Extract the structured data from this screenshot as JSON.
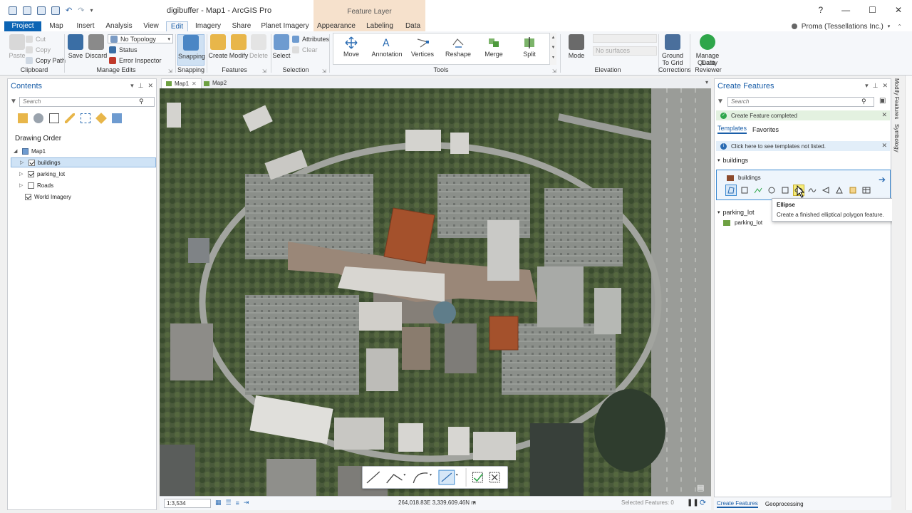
{
  "app": {
    "title": "digibuffer - Map1 - ArcGIS Pro",
    "context_tab_group": "Feature Layer",
    "window_controls": [
      "?",
      "—",
      "☐",
      "✕"
    ]
  },
  "tabs": [
    "Project",
    "Map",
    "Insert",
    "Analysis",
    "View",
    "Edit",
    "Imagery",
    "Share",
    "Planet Imagery",
    "Appearance",
    "Labeling",
    "Data"
  ],
  "active_tab": "Edit",
  "user": {
    "name": "Proma (Tessellations Inc.)"
  },
  "ribbon": {
    "clipboard": {
      "paste": "Paste",
      "cut": "Cut",
      "copy": "Copy",
      "copy_path": "Copy Path",
      "label": "Clipboard"
    },
    "manage_edits": {
      "save": "Save",
      "discard": "Discard",
      "topology_value": "No Topology",
      "status": "Status",
      "error_inspector": "Error Inspector",
      "label": "Manage Edits"
    },
    "snapping": {
      "button": "Snapping",
      "label": "Snapping"
    },
    "features": {
      "create": "Create",
      "modify": "Modify",
      "delete": "Delete",
      "label": "Features"
    },
    "selection": {
      "select": "Select",
      "attributes": "Attributes",
      "clear": "Clear",
      "label": "Selection"
    },
    "tools": {
      "items": [
        "Move",
        "Annotation",
        "Vertices",
        "Reshape",
        "Merge",
        "Split"
      ],
      "label": "Tools"
    },
    "elevation": {
      "mode": "Mode",
      "surface_placeholder": "No surfaces",
      "label": "Elevation"
    },
    "corrections": {
      "ground_to_grid": "Ground To Grid",
      "label": "Corrections"
    },
    "data_reviewer": {
      "manage_quality": "Manage Quality",
      "label": "Data Reviewer"
    }
  },
  "contents": {
    "title": "Contents",
    "search_placeholder": "Search",
    "drawing_order": "Drawing Order",
    "map_name": "Map1",
    "layers": [
      {
        "name": "buildings",
        "checked": true
      },
      {
        "name": "parking_lot",
        "checked": true
      },
      {
        "name": "Roads",
        "checked": false
      },
      {
        "name": "World Imagery",
        "checked": true
      }
    ]
  },
  "map_tabs": [
    "Map1",
    "Map2"
  ],
  "status_bar": {
    "scale": "1:3,534",
    "coordinates": "264,018.83E 3,339,609.46N m",
    "selected_features": "Selected Features: 0"
  },
  "create_features": {
    "title": "Create Features",
    "search_placeholder": "Search",
    "success_message": "Create Feature completed",
    "tabs": [
      "Templates",
      "Favorites"
    ],
    "info_message": "Click here to see templates not listed.",
    "groups": [
      {
        "name": "buildings",
        "template": "buildings",
        "swatch": "#8c4a2c"
      },
      {
        "name": "parking_lot",
        "template": "parking_lot",
        "swatch": "#6ea142"
      }
    ]
  },
  "tooltip": {
    "title": "Ellipse",
    "description": "Create a finished elliptical polygon feature."
  },
  "bottom_tabs": [
    "Create Features",
    "Geoprocessing"
  ],
  "side_tabs": [
    "Modify Features",
    "Symbology"
  ],
  "colors": {
    "accent": "#1a5ea8",
    "project_tab": "#0c64b4",
    "context_tab": "#f6e1cc",
    "building_fill": "#a4512c"
  }
}
